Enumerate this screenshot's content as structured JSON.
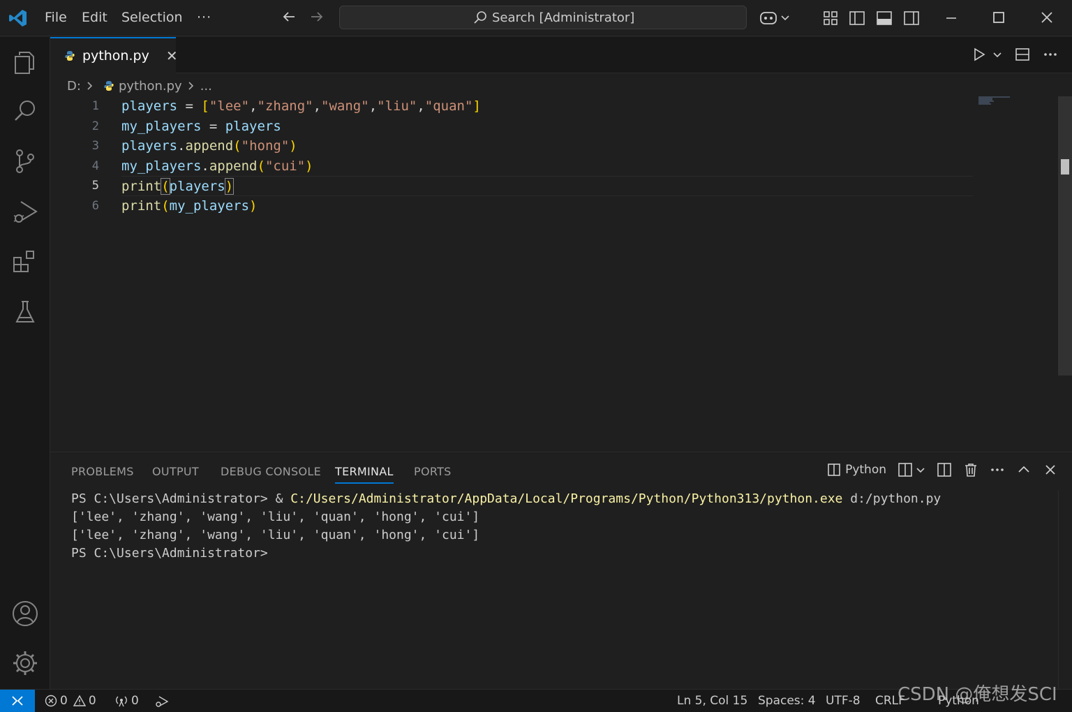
{
  "titlebar": {
    "menus": [
      "File",
      "Edit",
      "Selection"
    ],
    "more": "···",
    "search_text": "Search [Administrator]"
  },
  "tab": {
    "label": "python.py",
    "close": "✕"
  },
  "breadcrumb": {
    "drive": "D:",
    "file": "python.py",
    "more": "..."
  },
  "editor": {
    "line_numbers": [
      "1",
      "2",
      "3",
      "4",
      "5",
      "6"
    ],
    "active_line": 5
  },
  "panel": {
    "tabs": [
      "PROBLEMS",
      "OUTPUT",
      "DEBUG CONSOLE",
      "TERMINAL",
      "PORTS"
    ],
    "active_tab": "TERMINAL",
    "shell_label": "Python",
    "terminal": {
      "line1_prompt": "PS C:\\Users\\Administrator> & ",
      "line1_cmd": "C:/Users/Administrator/AppData/Local/Programs/Python/Python313/python.exe",
      "line1_arg": " d:/python.py",
      "line2": "['lee', 'zhang', 'wang', 'liu', 'quan', 'hong', 'cui']",
      "line3": "['lee', 'zhang', 'wang', 'liu', 'quan', 'hong', 'cui']",
      "line4": "PS C:\\Users\\Administrator>"
    }
  },
  "statusbar": {
    "errors": "0",
    "warnings": "0",
    "ports": "0",
    "position": "Ln 5, Col 15",
    "spaces": "Spaces: 4",
    "encoding": "UTF-8",
    "eol": "CRLF",
    "language": "Python"
  },
  "watermark": "CSDN @俺想发SCI",
  "colors": {
    "accent": "#0078d4",
    "variable": "#9cdcfe",
    "string": "#ce9178",
    "function": "#dcdcaa",
    "bracket": "#ffd700"
  }
}
